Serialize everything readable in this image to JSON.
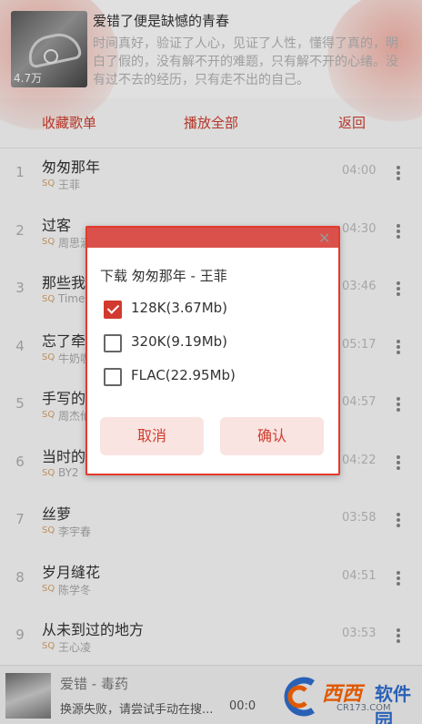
{
  "playlist": {
    "title": "爱错了便是缺憾的青春",
    "description": "时间真好，验证了人心，见证了人性，懂得了真的，明白了假的，没有解不开的难题，只有解不开的心绪。没有过不去的经历，只有走不出的自己。",
    "play_count": "4.7万"
  },
  "actions": {
    "collect": "收藏歌单",
    "play_all": "播放全部",
    "back": "返回"
  },
  "tracks": [
    {
      "num": "1",
      "title": "匆匆那年",
      "quality": "SQ",
      "artist": "王菲",
      "duration": "04:00"
    },
    {
      "num": "2",
      "title": "过客",
      "quality": "SQ",
      "artist": "周思涵",
      "duration": "04:30"
    },
    {
      "num": "3",
      "title": "那些我",
      "quality": "SQ",
      "artist": "Time",
      "duration": "03:46"
    },
    {
      "num": "4",
      "title": "忘了牵",
      "quality": "SQ",
      "artist": "牛奶咖",
      "duration": "05:17"
    },
    {
      "num": "5",
      "title": "手写的",
      "quality": "SQ",
      "artist": "周杰伦",
      "duration": "04:57"
    },
    {
      "num": "6",
      "title": "当时的",
      "quality": "SQ",
      "artist": "BY2",
      "duration": "04:22"
    },
    {
      "num": "7",
      "title": "丝萝",
      "quality": "SQ",
      "artist": "李宇春",
      "duration": "03:58"
    },
    {
      "num": "8",
      "title": "岁月缝花",
      "quality": "SQ",
      "artist": "陈学冬",
      "duration": "04:51"
    },
    {
      "num": "9",
      "title": "从未到过的地方",
      "quality": "SQ",
      "artist": "王心凌",
      "duration": "03:53"
    }
  ],
  "player": {
    "song": "爱错 - 毒药",
    "status": "换源失败，请尝试手动在搜...",
    "time": "00:0"
  },
  "watermark": {
    "text1": "西西",
    "text2": "软件园",
    "url": "CR173.COM"
  },
  "dialog": {
    "title": "下载 匆匆那年 - 王菲",
    "options": [
      {
        "label": "128K(3.67Mb)",
        "checked": true
      },
      {
        "label": "320K(9.19Mb)",
        "checked": false
      },
      {
        "label": "FLAC(22.95Mb)",
        "checked": false
      }
    ],
    "cancel": "取消",
    "confirm": "确认"
  },
  "colors": {
    "accent": "#cf3d2e",
    "dialog_border": "#e23a2c",
    "dialog_bar": "#d9514a",
    "quality_tag": "#d6a36b"
  }
}
